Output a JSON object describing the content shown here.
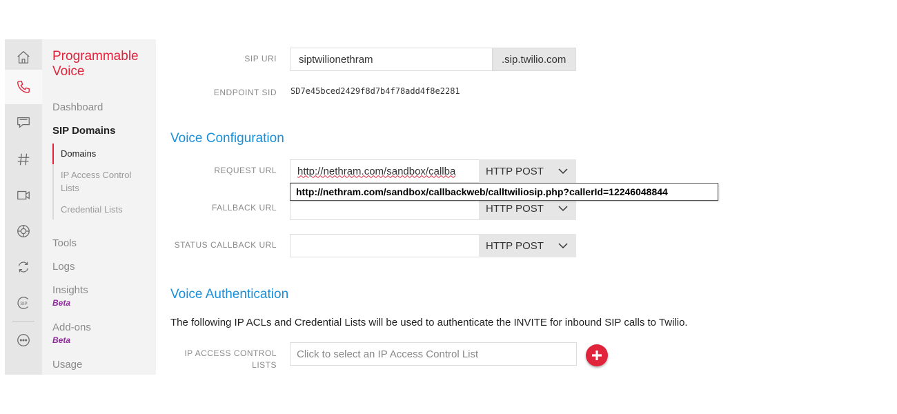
{
  "nav": {
    "title": "Programmable Voice",
    "items": {
      "dashboard": "Dashboard",
      "sip_domains": "SIP Domains",
      "domains": "Domains",
      "ip_access_control_lists": "IP Access Control Lists",
      "credential_lists": "Credential Lists",
      "tools": "Tools",
      "logs": "Logs",
      "insights": "Insights",
      "insights_badge": "Beta",
      "addons": "Add-ons",
      "addons_badge": "Beta",
      "usage": "Usage"
    }
  },
  "rail": {
    "icons": [
      "home-icon",
      "phone-icon",
      "chat-icon",
      "hash-icon",
      "video-icon",
      "lifebuoy-icon",
      "sync-icon",
      "sip-icon",
      "more-icon"
    ],
    "sip_icon_text": "SIP"
  },
  "form": {
    "sip_uri": {
      "label": "SIP URI",
      "value": "siptwilionethram",
      "suffix": ".sip.twilio.com"
    },
    "endpoint_sid": {
      "label": "ENDPOINT SID",
      "value": "SD7e45bced2429f8d7b4f78add4f8e2281"
    }
  },
  "voice_config": {
    "title": "Voice Configuration",
    "request_url": {
      "label": "REQUEST URL",
      "value": "http://nethram.com/sandbox/callba",
      "method": "HTTP POST"
    },
    "tooltip": "http://nethram.com/sandbox/callbackweb/calltwiliosip.php?callerId=12246048844",
    "fallback_url": {
      "label": "FALLBACK URL",
      "value": "",
      "method": "HTTP POST"
    },
    "status_callback_url": {
      "label": "STATUS CALLBACK URL",
      "value": "",
      "method": "HTTP POST"
    }
  },
  "voice_auth": {
    "title": "Voice Authentication",
    "description": "The following IP ACLs and Credential Lists will be used to authenticate the INVITE for inbound SIP calls to Twilio.",
    "ip_acl": {
      "label_line1": "IP ACCESS CONTROL",
      "label_line2": "LISTS",
      "placeholder": "Click to select an IP Access Control List"
    }
  },
  "colors": {
    "accent_red": "#e0243c",
    "link_blue": "#1a8fd8",
    "beta_purple": "#8e2c9a"
  }
}
